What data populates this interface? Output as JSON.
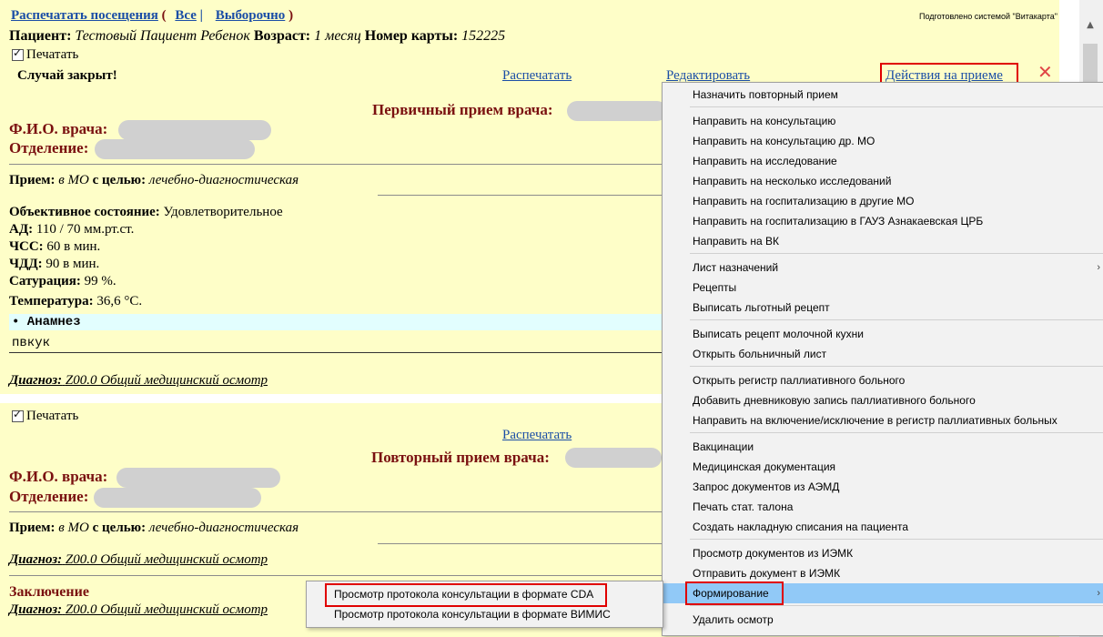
{
  "header": {
    "print_visits": "Распечатать посещения",
    "open_paren": "(",
    "all": "Все",
    "separator": "|",
    "selective": "Выборочно",
    "close_paren": ")",
    "powered_by": "Подготовлено системой \"Витакарта\""
  },
  "patient": {
    "label": "Пациент:",
    "name": "Тестовый Пациент Ребенок",
    "age_label": "Возраст:",
    "age": "1 месяц",
    "card_label": "Номер карты:",
    "card": "152225"
  },
  "visit1": {
    "print_checkbox": "Печатать",
    "case_closed": "Случай закрыт!",
    "print_link": "Распечатать",
    "edit_link": "Редактировать",
    "actions_link": "Действия на приеме",
    "title": "Первичный прием врача:",
    "doctor_label": "Ф.И.О. врача:",
    "department_label": "Отделение:",
    "reception_label": "Прием:",
    "reception_place": "в МО",
    "purpose_label": "с целью:",
    "purpose": "лечебно-диагностическая",
    "objective_label": "Объективное состояние:",
    "objective": "Удовлетворительное",
    "bp_label": "АД:",
    "bp": "110 / 70 мм.рт.ст.",
    "hr_label": "ЧСС:",
    "hr": "60 в мин.",
    "rr_label": "ЧДД:",
    "rr": "90 в мин.",
    "sat_label": "Сатурация:",
    "sat": "99 %.",
    "temp_label": "Температура:",
    "temp": "36,6 °С.",
    "anamnesis_label": "• Анамнез",
    "anamnesis_text": "пвкук",
    "diagnosis_label": "Диагноз:",
    "diagnosis": "Z00.0 Общий медицинский осмотр"
  },
  "visit2": {
    "print_checkbox": "Печатать",
    "print_link": "Распечатать",
    "title": "Повторный прием врача:",
    "doctor_label": "Ф.И.О. врача:",
    "department_label": "Отделение:",
    "reception_label": "Прием:",
    "reception_place": "в МО",
    "purpose_label": "с целью:",
    "purpose": "лечебно-диагностическая",
    "diagnosis_label": "Диагноз:",
    "diagnosis": "Z00.0 Общий медицинский осмотр",
    "conclusion_label": "Заключение",
    "diagnosis2_label": "Диагноз:",
    "diagnosis2": "Z00.0 Общий медицинский осмотр"
  },
  "context_menu": {
    "items": [
      "Назначить повторный прием",
      "Направить на консультацию",
      "Направить на консультацию др. МО",
      "Направить на исследование",
      "Направить на несколько исследований",
      "Направить на госпитализацию в другие МО",
      "Направить на госпитализацию в ГАУЗ Азнакаевская ЦРБ",
      "Направить на ВК",
      "Лист назначений",
      "Рецепты",
      "Выписать льготный рецепт",
      "Выписать рецепт молочной кухни",
      "Открыть больничный лист",
      "Открыть регистр паллиативного больного",
      "Добавить дневниковую запись паллиативного больного",
      "Направить на включение/исключение в регистр паллиативных больных",
      "Вакцинации",
      "Медицинская документация",
      "Запрос документов из АЭМД",
      "Печать стат. талона",
      "Создать накладную списания на пациента",
      "Просмотр документов из ИЭМК",
      "Отправить документ в ИЭМК",
      "Формирование",
      "Удалить осмотр"
    ],
    "submenu_arrow": "›"
  },
  "submenu": {
    "items": [
      "Просмотр протокола консультации в формате CDA",
      "Просмотр протокола консультации в формате ВИМИС"
    ]
  },
  "colors": {
    "page_bg": "#fefec8",
    "link": "#1b4ea6",
    "maroon": "#7a1010",
    "highlight_box": "#e00000",
    "menu_active": "#91c9f7"
  }
}
